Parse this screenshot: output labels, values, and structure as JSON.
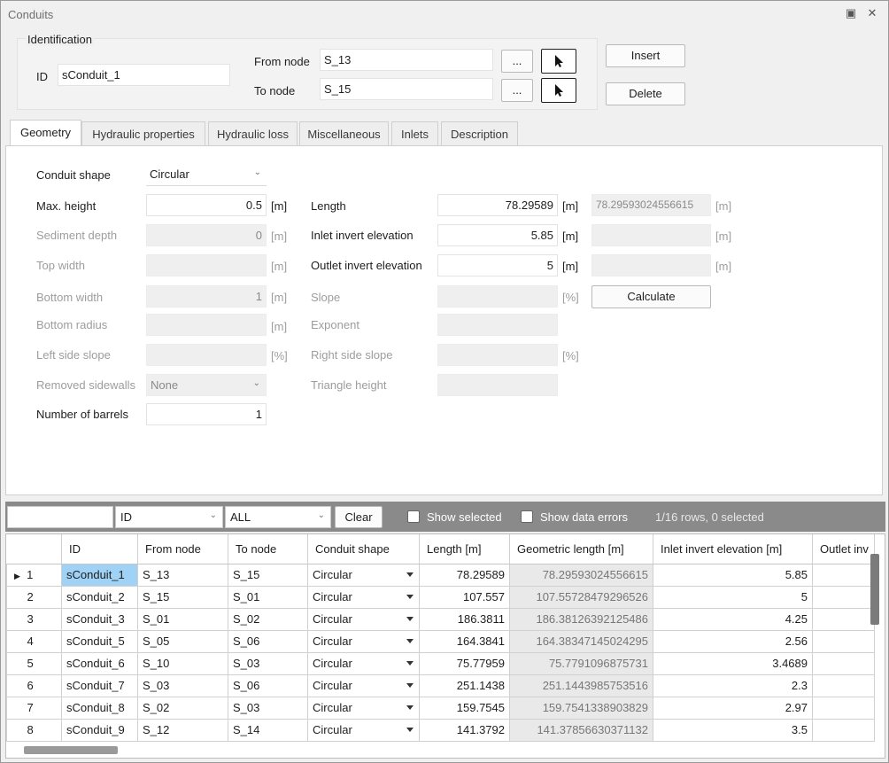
{
  "window": {
    "title": "Conduits",
    "restore_icon": "restore-icon",
    "close_icon": "close-icon"
  },
  "identification": {
    "group_label": "Identification",
    "id_label": "ID",
    "id_value": "sConduit_1",
    "from_node_label": "From node",
    "from_node_value": "S_13",
    "to_node_label": "To node",
    "to_node_value": "S_15",
    "browse_label": "...",
    "insert_label": "Insert",
    "delete_label": "Delete"
  },
  "tabs": [
    {
      "label": "Geometry"
    },
    {
      "label": "Hydraulic properties"
    },
    {
      "label": "Hydraulic loss"
    },
    {
      "label": "Miscellaneous"
    },
    {
      "label": "Inlets"
    },
    {
      "label": "Description"
    }
  ],
  "geometry": {
    "conduit_shape_label": "Conduit shape",
    "conduit_shape_value": "Circular",
    "max_height_label": "Max. height",
    "max_height_value": "0.5",
    "sediment_depth_label": "Sediment depth",
    "sediment_depth_value": "0",
    "top_width_label": "Top width",
    "bottom_width_label": "Bottom width",
    "bottom_width_value": "1",
    "bottom_radius_label": "Bottom radius",
    "left_side_slope_label": "Left side slope",
    "removed_sidewalls_label": "Removed sidewalls",
    "removed_sidewalls_value": "None",
    "number_of_barrels_label": "Number of barrels",
    "number_of_barrels_value": "1",
    "length_label": "Length",
    "length_value": "78.29589",
    "length_computed": "78.29593024556615",
    "inlet_invert_label": "Inlet invert elevation",
    "inlet_invert_value": "5.85",
    "outlet_invert_label": "Outlet invert elevation",
    "outlet_invert_value": "5",
    "slope_label": "Slope",
    "exponent_label": "Exponent",
    "right_side_slope_label": "Right side slope",
    "triangle_height_label": "Triangle height",
    "calculate_label": "Calculate",
    "unit_m": "[m]",
    "unit_pct": "[%]"
  },
  "filter": {
    "search_value": "",
    "column_value": "ID",
    "scope_value": "ALL",
    "clear_label": "Clear",
    "show_selected_label": "Show selected",
    "show_errors_label": "Show data errors",
    "rows_info": "1/16 rows, 0 selected"
  },
  "grid": {
    "columns": [
      "",
      "ID",
      "From node",
      "To node",
      "Conduit shape",
      "Length [m]",
      "Geometric length [m]",
      "Inlet invert elevation [m]",
      "Outlet inv"
    ],
    "rows": [
      {
        "n": "1",
        "id": "sConduit_1",
        "from": "S_13",
        "to": "S_15",
        "shape": "Circular",
        "length": "78.29589",
        "geo": "78.29593024556615",
        "inlet": "5.85"
      },
      {
        "n": "2",
        "id": "sConduit_2",
        "from": "S_15",
        "to": "S_01",
        "shape": "Circular",
        "length": "107.557",
        "geo": "107.55728479296526",
        "inlet": "5"
      },
      {
        "n": "3",
        "id": "sConduit_3",
        "from": "S_01",
        "to": "S_02",
        "shape": "Circular",
        "length": "186.3811",
        "geo": "186.38126392125486",
        "inlet": "4.25"
      },
      {
        "n": "4",
        "id": "sConduit_5",
        "from": "S_05",
        "to": "S_06",
        "shape": "Circular",
        "length": "164.3841",
        "geo": "164.38347145024295",
        "inlet": "2.56"
      },
      {
        "n": "5",
        "id": "sConduit_6",
        "from": "S_10",
        "to": "S_03",
        "shape": "Circular",
        "length": "75.77959",
        "geo": "75.7791096875731",
        "inlet": "3.4689"
      },
      {
        "n": "6",
        "id": "sConduit_7",
        "from": "S_03",
        "to": "S_06",
        "shape": "Circular",
        "length": "251.1438",
        "geo": "251.1443985753516",
        "inlet": "2.3"
      },
      {
        "n": "7",
        "id": "sConduit_8",
        "from": "S_02",
        "to": "S_03",
        "shape": "Circular",
        "length": "159.7545",
        "geo": "159.7541338903829",
        "inlet": "2.97"
      },
      {
        "n": "8",
        "id": "sConduit_9",
        "from": "S_12",
        "to": "S_14",
        "shape": "Circular",
        "length": "141.3792",
        "geo": "141.37856630371132",
        "inlet": "3.5"
      }
    ]
  }
}
